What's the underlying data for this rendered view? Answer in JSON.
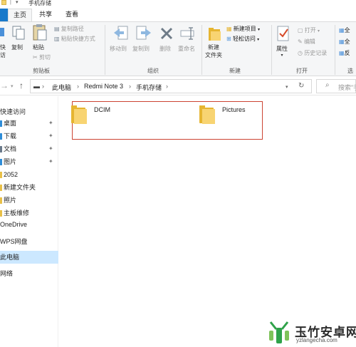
{
  "window": {
    "title": "手机存储"
  },
  "ribbon_tabs": {
    "file": "",
    "home": "主页",
    "share": "共享",
    "view": "查看"
  },
  "ribbon": {
    "clipboard": {
      "pin_label": "快",
      "pin_label2": "访",
      "copy": "复制",
      "paste": "粘贴",
      "copy_path": "复制路径",
      "paste_shortcut": "粘贴快捷方式",
      "cut": "剪切",
      "group": "剪贴板"
    },
    "organize": {
      "move_to": "移动到",
      "copy_to": "复制到",
      "delete": "删除",
      "rename": "重命名",
      "group": "组织"
    },
    "new": {
      "new_folder_line1": "新建",
      "new_folder_line2": "文件夹",
      "new_item": "新建项目",
      "easy_access": "轻松访问",
      "group": "新建"
    },
    "open": {
      "properties": "属性",
      "open": "打开",
      "edit": "编辑",
      "history": "历史记录",
      "group": "打开"
    },
    "select": {
      "select_all": "全",
      "select_none": "全",
      "invert": "反",
      "group": "选"
    }
  },
  "address": {
    "crumbs": [
      "此电脑",
      "Redmi Note 3",
      "手机存储"
    ],
    "search_placeholder": "搜索\"手"
  },
  "nav_pane": {
    "quick_access": "快速访问",
    "items": [
      {
        "label": "桌面",
        "color": "#2f8dd8"
      },
      {
        "label": "下载",
        "color": "#2f8dd8"
      },
      {
        "label": "文档",
        "color": "#6b7a8a"
      },
      {
        "label": "图片",
        "color": "#2f8dd8"
      },
      {
        "label": "2052",
        "color": "#e8c048"
      },
      {
        "label": "新建文件夹",
        "color": "#e8c048"
      },
      {
        "label": "照片",
        "color": "#e8c048"
      },
      {
        "label": "主板维修",
        "color": "#e8c048"
      }
    ],
    "onedrive": "OneDrive",
    "wps": "WPS网盘",
    "this_pc": "此电脑",
    "network": "网络"
  },
  "folders": [
    {
      "name": "DCIM"
    },
    {
      "name": "Pictures"
    }
  ],
  "watermark": {
    "name": "玉竹安卓网",
    "url": "yzlangecha.com"
  },
  "colors": {
    "accent": "#1979ca",
    "folder": "#f8d472",
    "highlight": "#cc4433",
    "selected": "#cce8ff"
  }
}
